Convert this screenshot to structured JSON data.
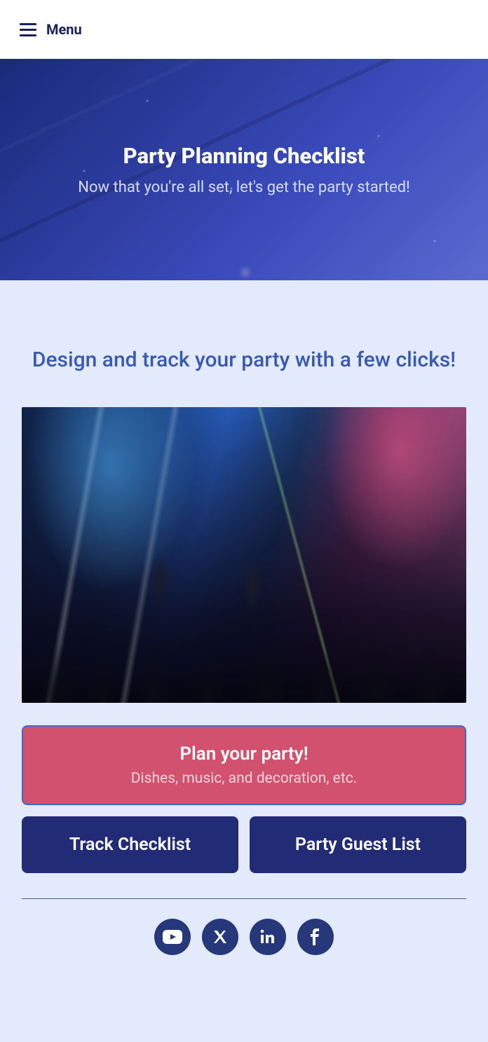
{
  "header": {
    "menu_label": "Menu"
  },
  "hero": {
    "title": "Party Planning Checklist",
    "subtitle": "Now that you're all set, let's get the party started!"
  },
  "main": {
    "section_title": "Design and track your party with a few clicks!",
    "cta_primary": {
      "title": "Plan your party!",
      "subtitle": "Dishes, music, and decoration, etc."
    },
    "cta_track": "Track Checklist",
    "cta_guest": "Party Guest List"
  },
  "social": {
    "youtube": "youtube-icon",
    "x": "x-icon",
    "linkedin": "linkedin-icon",
    "facebook": "facebook-icon"
  }
}
